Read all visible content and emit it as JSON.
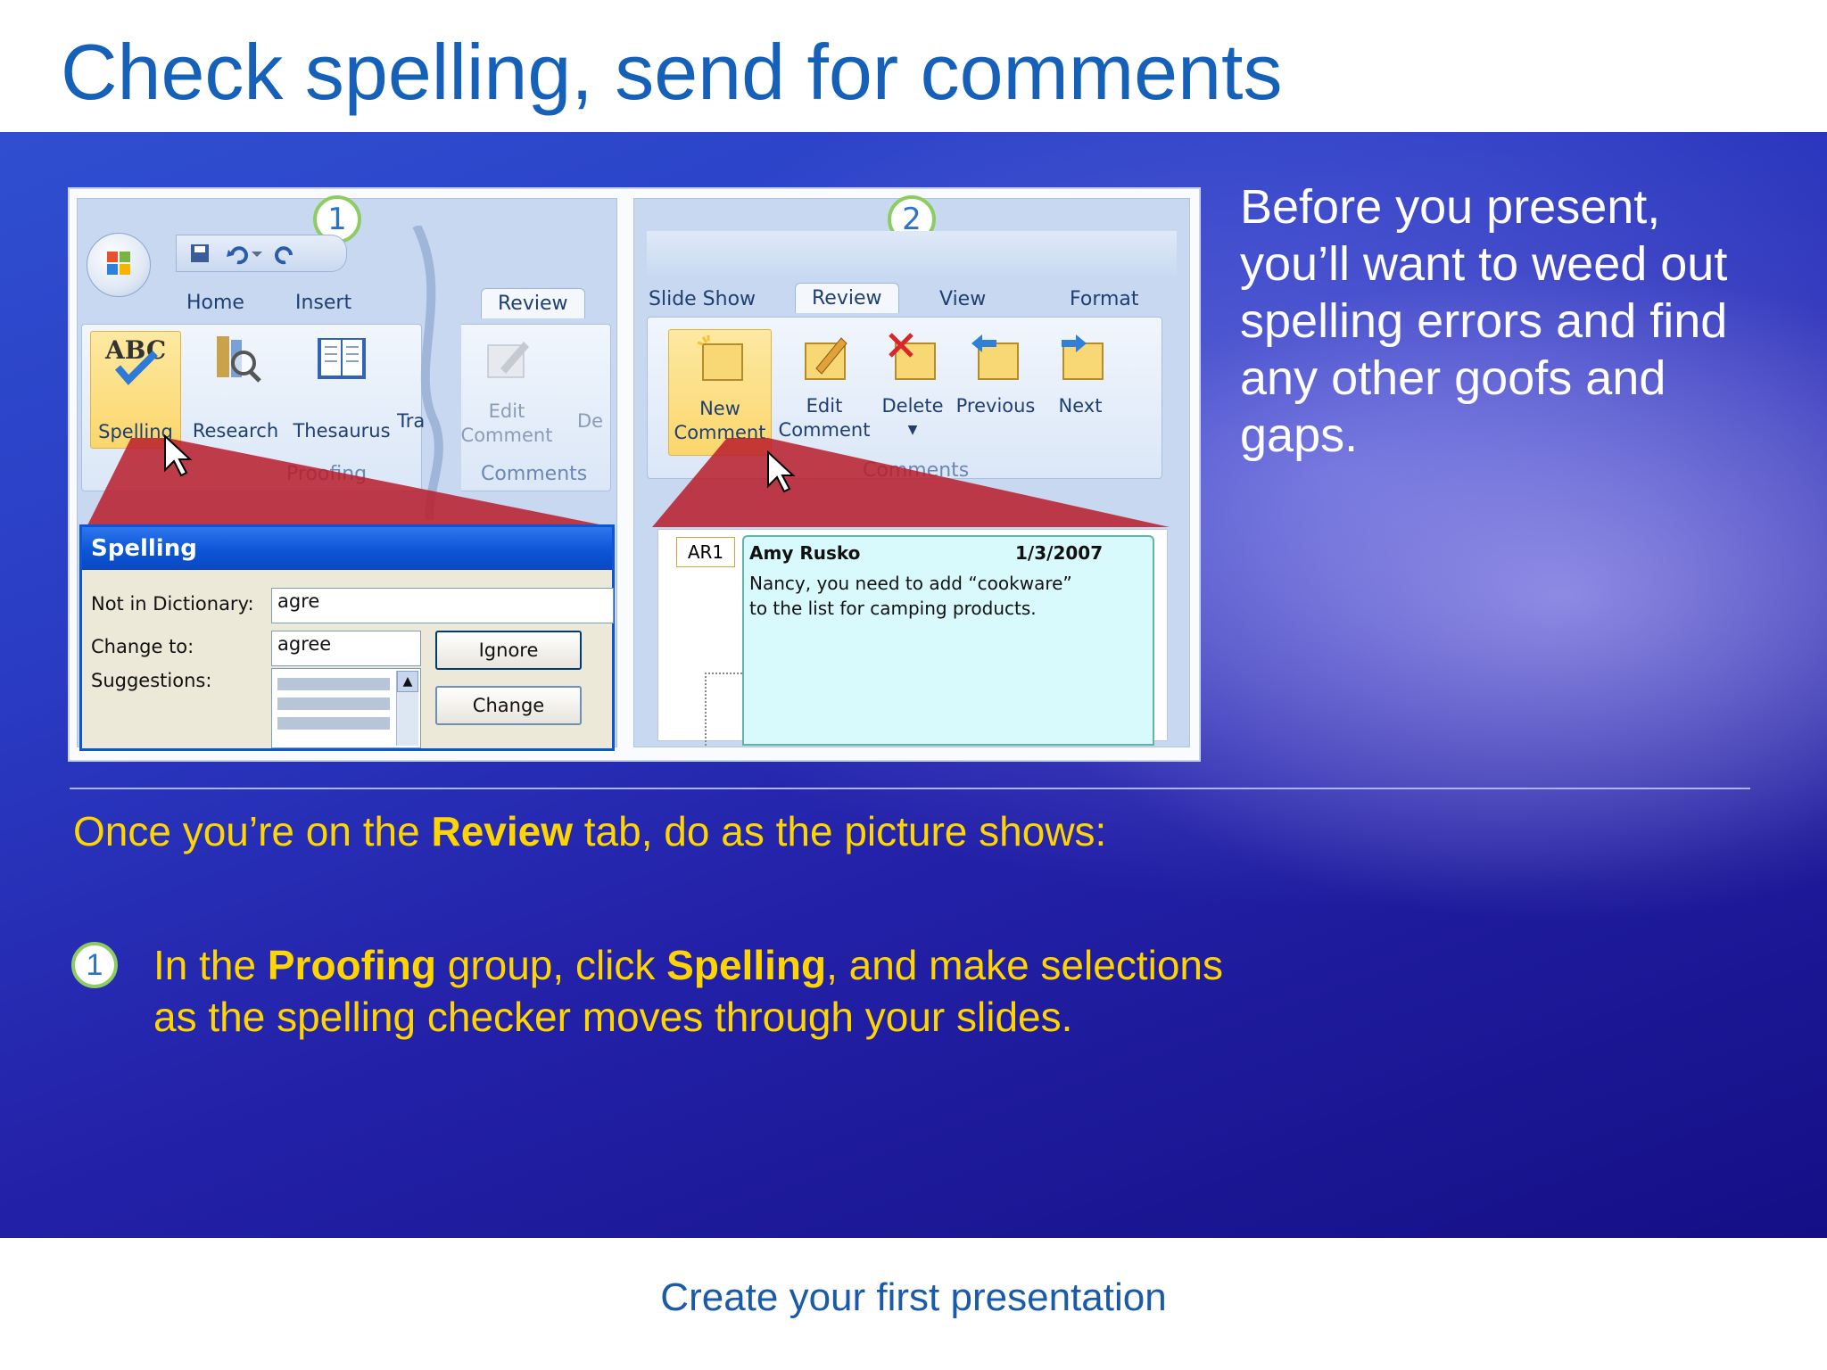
{
  "slide": {
    "title": "Check spelling, send for comments",
    "footer": "Create your first presentation",
    "side_text": "Before you present, you’ll want to weed out spelling errors and find any other goofs and gaps.",
    "intro": {
      "pre": "Once you’re on the ",
      "bold": "Review",
      "post": " tab, do as the picture shows:"
    },
    "step1": {
      "number": "1",
      "a": "In the ",
      "b1": "Proofing",
      "c": " group, click ",
      "b2": "Spelling",
      "d": ", and make selections as the spelling checker moves through your slides."
    },
    "colors": {
      "title": "#1560b8",
      "accent_text": "#ffd500",
      "background": "#2321a8"
    }
  },
  "screenshot1": {
    "callout": "1",
    "tabs": [
      "Home",
      "Insert",
      "Review"
    ],
    "buttons": {
      "spelling": "Spelling",
      "research": "Research",
      "thesaurus": "Thesaurus",
      "translate": "Tra",
      "edit_comment_1": "Edit",
      "edit_comment_2": "Comment",
      "delete_partial": "De"
    },
    "groups": {
      "proofing": "Proofing",
      "comments": "Comments"
    },
    "dialog": {
      "title": "Spelling",
      "not_in_dictionary_label": "Not in Dictionary:",
      "not_in_dictionary_value": "agre",
      "change_to_label": "Change to:",
      "change_to_value": "agree",
      "suggestions_label": "Suggestions:",
      "ignore_button": "Ignore",
      "change_button": "Change"
    },
    "icons": [
      "office-button-icon",
      "save-icon",
      "undo-icon",
      "redo-icon",
      "spelling-abc-icon",
      "research-icon",
      "thesaurus-icon",
      "edit-comment-icon",
      "mouse-cursor-icon"
    ]
  },
  "screenshot2": {
    "callout": "2",
    "tabs": [
      "Slide Show",
      "Review",
      "View",
      "Format"
    ],
    "buttons": {
      "new_comment_1": "New",
      "new_comment_2": "Comment",
      "edit_comment_1": "Edit",
      "edit_comment_2": "Comment",
      "delete": "Delete",
      "previous": "Previous",
      "next": "Next"
    },
    "group": "Comments",
    "comment": {
      "marker": "AR1",
      "author": "Amy Rusko",
      "date": "1/3/2007",
      "line1": "Nancy, you need to add “cookware”",
      "line2": "to the list for camping products."
    },
    "icons": [
      "new-comment-icon",
      "edit-comment-icon",
      "delete-comment-icon",
      "previous-comment-icon",
      "next-comment-icon",
      "mouse-cursor-icon"
    ]
  }
}
